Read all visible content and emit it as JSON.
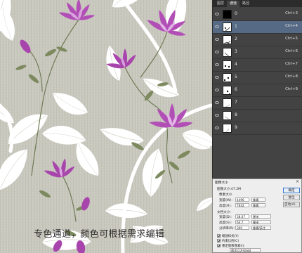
{
  "caption": "专色通道，颜色可根据需求编辑",
  "channels_panel": {
    "tabs": [
      "图层",
      "通道",
      "路径"
    ],
    "active_tab": 1,
    "rows": [
      {
        "name": "0",
        "shortcut": "Ctrl+3",
        "selected": false,
        "thumb": "black"
      },
      {
        "name": "1",
        "shortcut": "Ctrl+4",
        "selected": true,
        "thumb": "pattern"
      },
      {
        "name": "2",
        "shortcut": "Ctrl+5",
        "selected": false,
        "thumb": "pattern"
      },
      {
        "name": "3",
        "shortcut": "Ctrl+6",
        "selected": false,
        "thumb": "pattern"
      },
      {
        "name": "4",
        "shortcut": "Ctrl+7",
        "selected": false,
        "thumb": "dots"
      },
      {
        "name": "5",
        "shortcut": "Ctrl+8",
        "selected": false,
        "thumb": "dots"
      },
      {
        "name": "6",
        "shortcut": "Ctrl+9",
        "selected": false,
        "thumb": "dots"
      },
      {
        "name": "7",
        "shortcut": "",
        "selected": false,
        "thumb": "light"
      },
      {
        "name": "8",
        "shortcut": "",
        "selected": false,
        "thumb": "light"
      },
      {
        "name": "9",
        "shortcut": "",
        "selected": false,
        "thumb": "light"
      }
    ]
  },
  "image_size_dialog": {
    "title": "图像大小",
    "image_size_label": "图像大小:47.2M",
    "pixel_dimensions": "像素大小",
    "width_label": "宽度(W):",
    "width_value": "4496",
    "height_label": "高度(H):",
    "height_value": "7642",
    "pixel_unit": "像素",
    "doc_size_label": "文档大小:",
    "doc_width_label": "宽度(D):",
    "doc_width_value": "38.07",
    "doc_height_label": "高度(G):",
    "doc_height_value": "64.7",
    "resolution_label": "分辨率(R):",
    "resolution_value": "300",
    "cm_unit": "厘米",
    "res_unit": "像素/英寸",
    "ok_label": "确定",
    "cancel_label": "复位",
    "auto_label": "自动(A)...",
    "scale_styles": "缩放样式(Y)",
    "constrain": "约束比例(C)",
    "resample": "重定图像像素(I):",
    "resample_method": "两次立方(自动)"
  },
  "colors": {
    "flower": "#b24fb6",
    "flower_dark": "#8a2e93",
    "leaf_white": "#ffffff",
    "stem": "#6f7b55",
    "background": "#c9c8be",
    "panel_bg": "#434343",
    "selected_row": "#566a86"
  }
}
